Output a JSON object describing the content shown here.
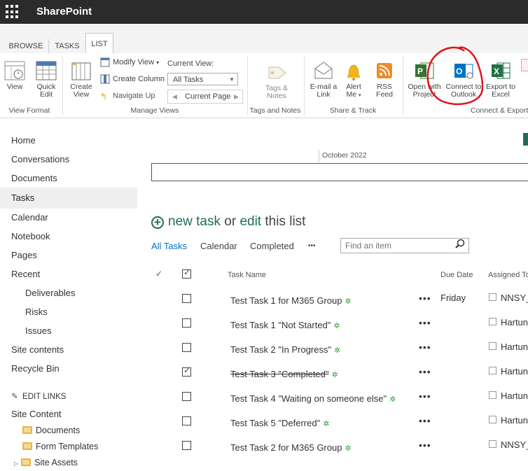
{
  "suite": {
    "brand": "SharePoint"
  },
  "ribbon_tabs": [
    "BROWSE",
    "TASKS",
    "LIST"
  ],
  "ribbon": {
    "view_format": {
      "view": "View",
      "quick_edit_1": "Quick",
      "quick_edit_2": "Edit",
      "group": "View Format"
    },
    "manage_views": {
      "create_view_1": "Create",
      "create_view_2": "View",
      "modify_view": "Modify View",
      "create_column": "Create Column",
      "navigate_up": "Navigate Up",
      "current_view_label": "Current View:",
      "current_view_value": "All Tasks",
      "current_page": "Current Page",
      "group": "Manage Views"
    },
    "tags_notes": {
      "label_1": "Tags &",
      "label_2": "Notes",
      "group": "Tags and Notes"
    },
    "share_track": {
      "email_1": "E-mail a",
      "email_2": "Link",
      "alert_1": "Alert",
      "alert_2": "Me",
      "rss_1": "RSS",
      "rss_2": "Feed",
      "group": "Share & Track"
    },
    "connect_export": {
      "project_1": "Open with",
      "project_2": "Project",
      "outlook_1": "Connect to",
      "outlook_2": "Outlook",
      "excel_1": "Export to",
      "excel_2": "Excel",
      "group": "Connect & Export"
    }
  },
  "nav": {
    "items": [
      "Home",
      "Conversations",
      "Documents",
      "Tasks",
      "Calendar",
      "Notebook",
      "Pages",
      "Recent"
    ],
    "recent": [
      "Deliverables",
      "Risks",
      "Issues"
    ],
    "bottom": [
      "Site contents",
      "Recycle Bin"
    ],
    "edit_links": "EDIT LINKS",
    "site_content": "Site Content",
    "folders": [
      "Documents",
      "Form Templates",
      "Site Assets"
    ]
  },
  "timeline": {
    "month": "October 2022"
  },
  "list": {
    "new_task": "new task",
    "or": "or",
    "edit": "edit",
    "this_list": "this list",
    "views": [
      "All Tasks",
      "Calendar",
      "Completed",
      "•••"
    ],
    "search_placeholder": "Find an item",
    "headers": {
      "task_name": "Task Name",
      "due_date": "Due Date",
      "assigned_to": "Assigned To"
    },
    "rows": [
      {
        "name": "Test Task 1 for M365 Group",
        "due": "Friday",
        "assigned": "NNSY_",
        "checked": false
      },
      {
        "name": "Test Task 1 \"Not Started\"",
        "due": "",
        "assigned": "Hartung",
        "checked": false
      },
      {
        "name": "Test Task 2 \"In Progress\"",
        "due": "",
        "assigned": "Hartung",
        "checked": false
      },
      {
        "name": "Test Task 3 \"Completed\"",
        "due": "",
        "assigned": "Hartung",
        "checked": true
      },
      {
        "name": "Test Task 4 \"Waiting on someone else\"",
        "due": "",
        "assigned": "Hartung",
        "checked": false
      },
      {
        "name": "Test Task 5 \"Deferred\"",
        "due": "",
        "assigned": "Hartung",
        "checked": false
      },
      {
        "name": "Test Task 2 for M365 Group",
        "due": "",
        "assigned": "NNSY_",
        "checked": false
      }
    ]
  },
  "colors": {
    "accent": "#1f6c5e",
    "suitebar": "#2b2b2b",
    "annotation": "#e0141e",
    "link_blue": "#0072c6"
  }
}
